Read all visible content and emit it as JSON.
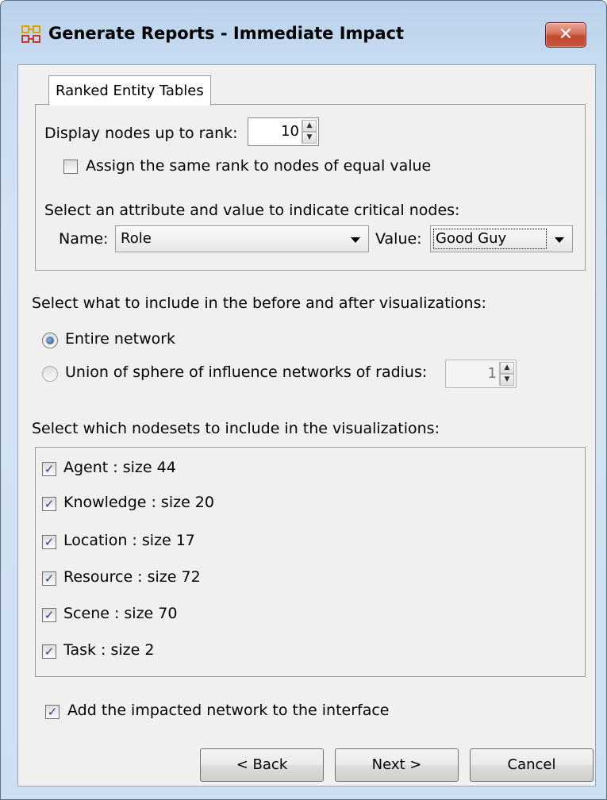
{
  "window": {
    "title": "Generate Reports - Immediate Impact",
    "close_label": "✕",
    "app_icon": "network-grid-icon",
    "accent_color": "#e0352a"
  },
  "tab": {
    "label": "Ranked Entity Tables"
  },
  "ranking": {
    "display_label": "Display nodes up to rank:",
    "rank_value": "10",
    "same_rank_label": "Assign the same rank to nodes of equal value",
    "same_rank_checked": false,
    "critical_label": "Select an attribute and value to indicate critical nodes:",
    "name_label": "Name:",
    "name_value": "Role",
    "value_label": "Value:",
    "value_value": "Good Guy"
  },
  "visualization": {
    "heading": "Select what to include in the before and after visualizations:",
    "option_entire": "Entire network",
    "option_union": "Union of sphere of influence networks of radius:",
    "selected": "entire",
    "radius_value": "1"
  },
  "nodesets": {
    "heading": "Select which nodesets to include in the visualizations:",
    "items": [
      {
        "label": "Agent : size 44",
        "checked": true
      },
      {
        "label": "Knowledge : size 20",
        "checked": true
      },
      {
        "label": "Location : size 17",
        "checked": true
      },
      {
        "label": "Resource : size 72",
        "checked": true
      },
      {
        "label": "Scene : size 70",
        "checked": true
      },
      {
        "label": "Task : size 2",
        "checked": true
      }
    ]
  },
  "add_network": {
    "label": "Add the impacted network to the interface",
    "checked": true
  },
  "buttons": {
    "back": "< Back",
    "next": "Next >",
    "cancel": "Cancel"
  }
}
